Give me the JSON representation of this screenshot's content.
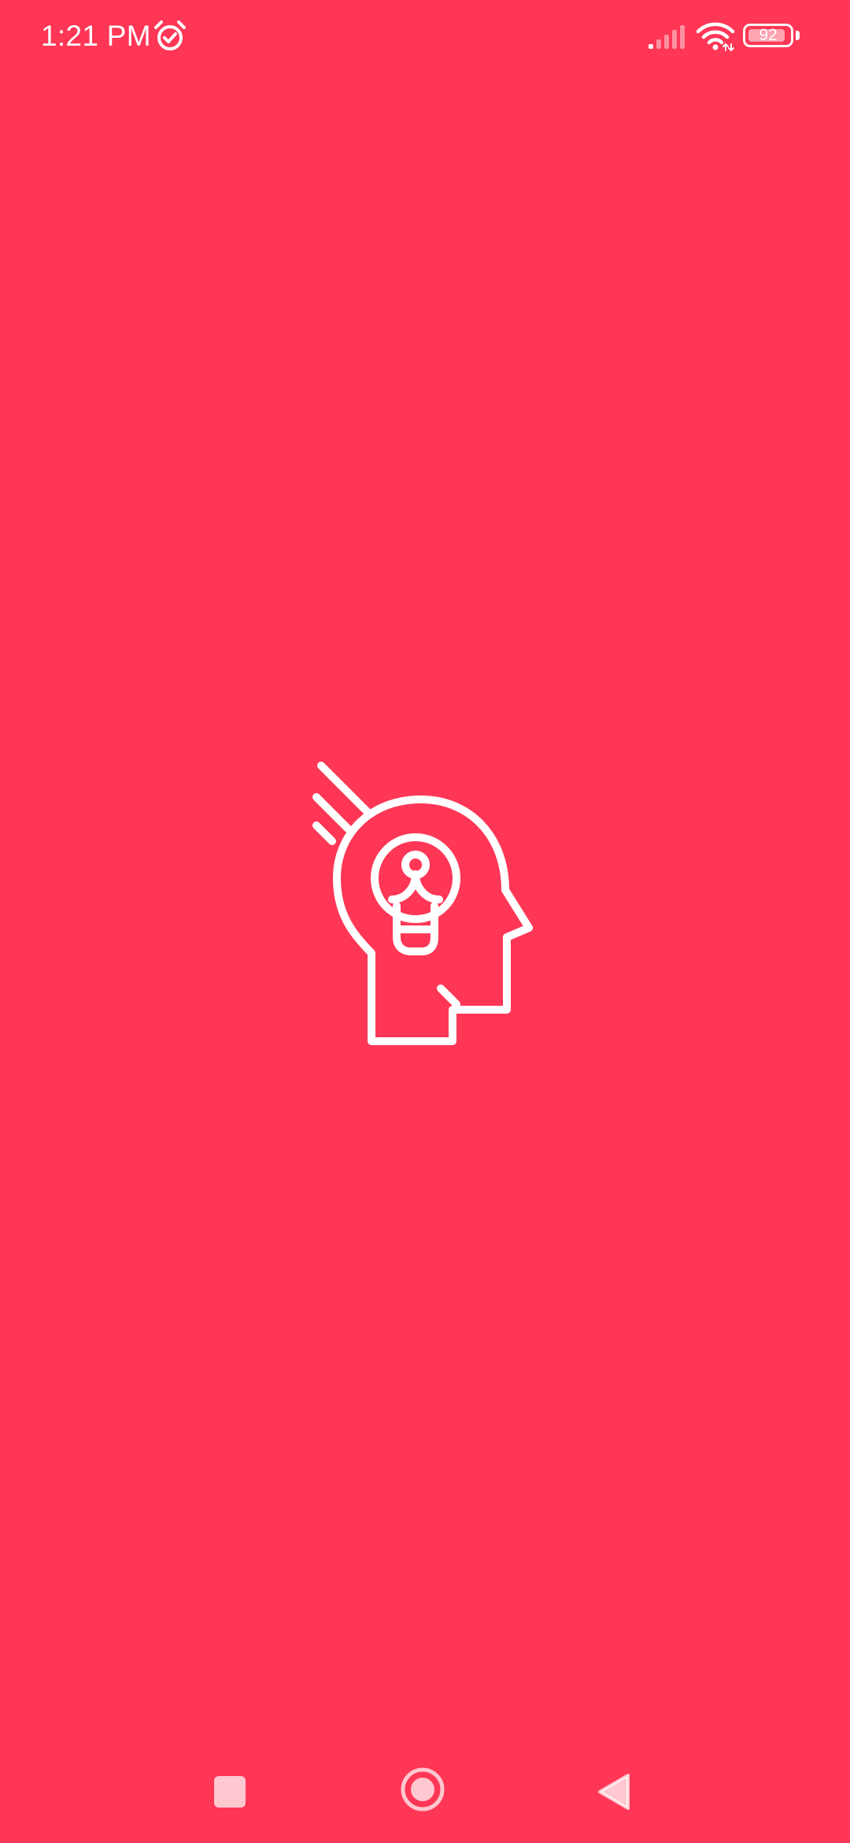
{
  "theme": {
    "background": "#FF3656",
    "foreground": "#FFFFFF"
  },
  "status_bar": {
    "time": "1:21 PM",
    "alarm_icon": "alarm-clock-icon",
    "signal_icon": "cellular-signal-icon",
    "wifi_icon": "wifi-icon",
    "battery_level": "92",
    "battery_fraction": 0.92
  },
  "splash": {
    "logo_icon": "head-lightbulb-idea-icon"
  },
  "nav_bar": {
    "recents_icon": "square-recents-icon",
    "home_icon": "circle-home-icon",
    "back_icon": "triangle-back-icon"
  }
}
